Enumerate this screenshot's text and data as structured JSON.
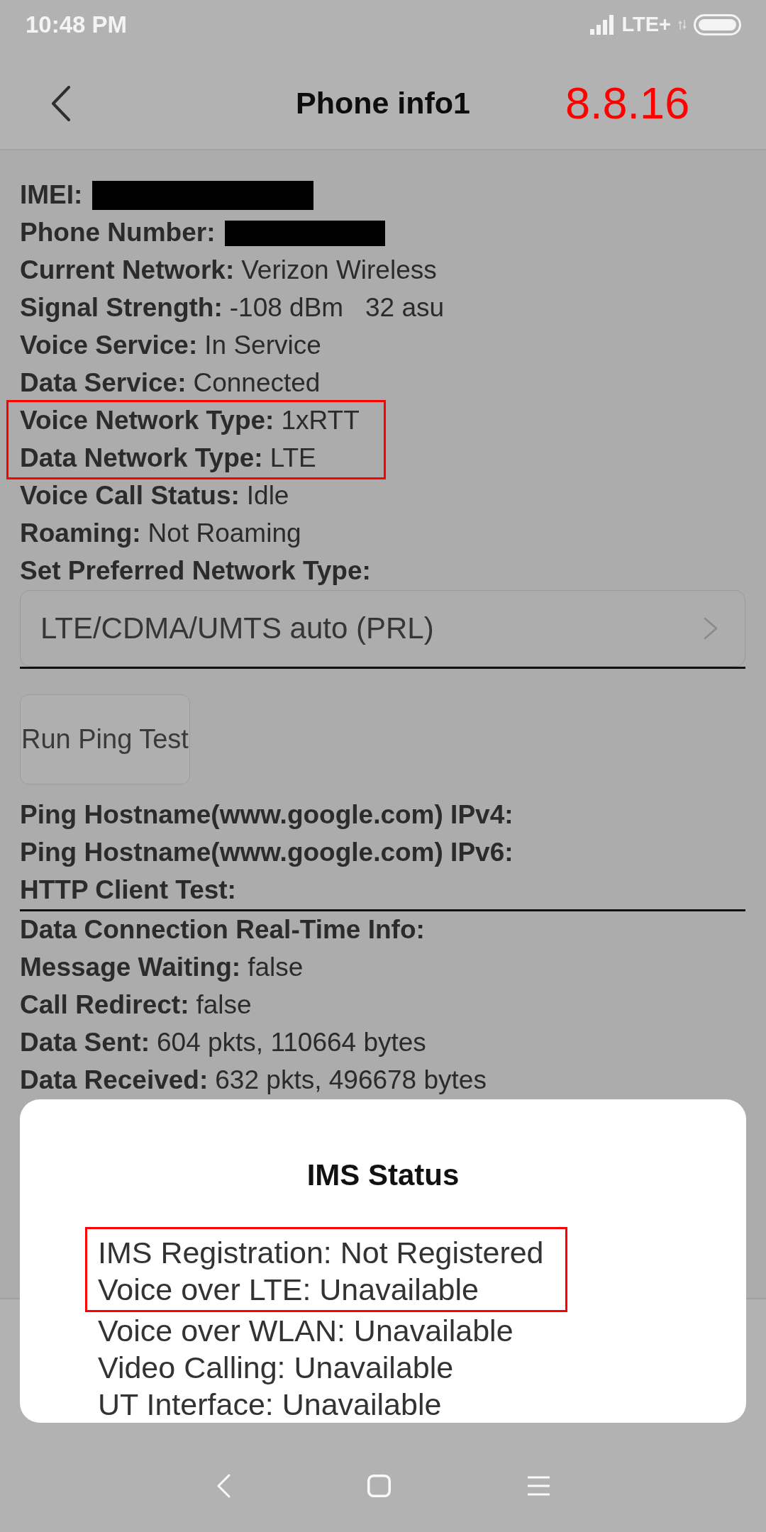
{
  "status_bar": {
    "time": "10:48 PM",
    "network": "LTE+"
  },
  "header": {
    "title": "Phone info1",
    "annotation": "8.8.16"
  },
  "info_rows": [
    {
      "label": "IMEI:",
      "redacted": true,
      "highlighted": false
    },
    {
      "label": "Phone Number:",
      "redacted": true,
      "highlighted": false
    },
    {
      "label": "Current Network:",
      "value": "Verizon Wireless",
      "redacted": false,
      "highlighted": false
    },
    {
      "label": "Signal Strength:",
      "value": "-108 dBm   32 asu",
      "redacted": false,
      "highlighted": false
    },
    {
      "label": "Voice Service:",
      "value": "In Service",
      "redacted": false,
      "highlighted": false
    },
    {
      "label": "Data Service:",
      "value": "Connected",
      "redacted": false,
      "highlighted": false
    },
    {
      "label": "Voice Network Type:",
      "value": "1xRTT",
      "redacted": false,
      "highlighted": true
    },
    {
      "label": "Data Network Type:",
      "value": "LTE",
      "redacted": false,
      "highlighted": true
    },
    {
      "label": "Voice Call Status:",
      "value": "Idle",
      "redacted": false,
      "highlighted": false
    },
    {
      "label": "Roaming:",
      "value": "Not Roaming",
      "redacted": false,
      "highlighted": false
    }
  ],
  "preferred_network": {
    "label": "Set Preferred Network Type:",
    "value": "LTE/CDMA/UMTS auto (PRL)"
  },
  "ping_button": {
    "label": "Run Ping Test"
  },
  "test_rows": [
    {
      "label": "Ping Hostname(www.google.com) IPv4:"
    },
    {
      "label": "Ping Hostname(www.google.com) IPv6:"
    },
    {
      "label": "HTTP Client Test:"
    }
  ],
  "connection_rows": [
    {
      "label": "Data Connection Real-Time Info:"
    },
    {
      "label": "Message Waiting:",
      "value": "false"
    },
    {
      "label": "Call Redirect:",
      "value": "false"
    },
    {
      "label": "Data Sent:",
      "value": "604 pkts, 110664 bytes"
    },
    {
      "label": "Data Received:",
      "value": "632 pkts, 496678 bytes"
    }
  ],
  "dialog": {
    "title": "IMS Status",
    "lines": [
      {
        "text": "IMS Registration: Not Registered",
        "highlighted": true
      },
      {
        "text": "Voice over LTE: Unavailable",
        "highlighted": true
      },
      {
        "text": "Voice over WLAN: Unavailable",
        "highlighted": false
      },
      {
        "text": "Video Calling: Unavailable",
        "highlighted": false
      },
      {
        "text": "UT Interface: Unavailable",
        "highlighted": false
      }
    ]
  }
}
